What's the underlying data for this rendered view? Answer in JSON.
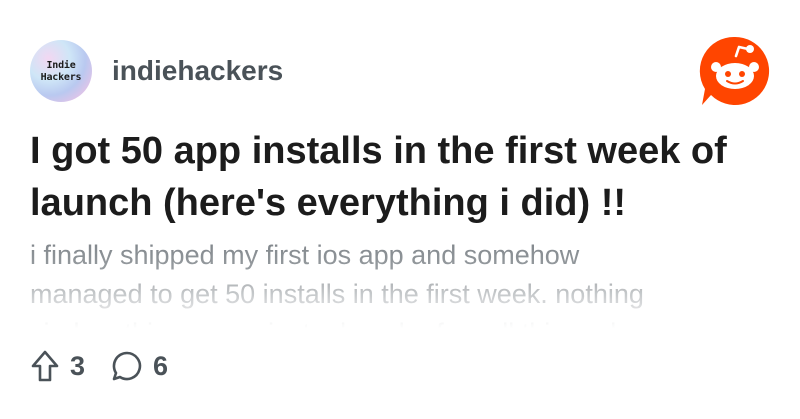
{
  "community": {
    "name": "indiehackers",
    "avatar_lines": [
      "Indie",
      "Hackers"
    ]
  },
  "brand": {
    "logo_icon": "reddit-logo-icon",
    "color": "#ff4500"
  },
  "post": {
    "title": "I got 50 app installs in the first week of launch (here's everything i did) !!",
    "preview_lines": [
      "i finally shipped my first ios app and somehow",
      "managed to get 50 installs in the first week. nothing",
      "viral, nothing crazy, just a bunch of small things done"
    ],
    "upvotes": "3",
    "comments": "6"
  },
  "icons": {
    "upvote": "upvote-arrow-icon",
    "comment": "comment-bubble-icon"
  }
}
